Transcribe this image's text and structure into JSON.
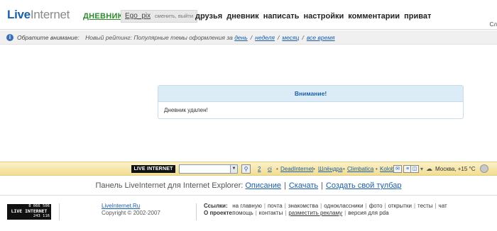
{
  "header": {
    "logo_live": "Live",
    "logo_internet": "Internet",
    "diaries_label": "ДНЕВНИКИ",
    "username": "Ego_pix",
    "user_links": "сменить, выйти",
    "menu": [
      "друзья",
      "дневник",
      "написать",
      "настройки",
      "комментарии",
      "приват"
    ],
    "corner_text": "Сл"
  },
  "notice": {
    "label": "Обратите внимание:",
    "text": "Новый рейтинг: Популярные темы оформления за",
    "links": [
      "день",
      "неделя",
      "месяц",
      "все время"
    ],
    "separator": "/"
  },
  "alert": {
    "title": "Внимание!",
    "message": "Дневник удален!"
  },
  "toolbar": {
    "logo_text": "LIVE INTERNET",
    "search_value": "",
    "count_2": "2",
    "count_ci": "ci",
    "links": [
      "DeadInternet",
      "Шлёндра",
      "Climbatica",
      "Kolob"
    ],
    "weather": "Москва, +15 °C"
  },
  "ie_panel": {
    "text": "Панель LiveInternet для Internet Explorer:",
    "links": [
      "Описание",
      "Скачать",
      "Создать свой тулбар"
    ],
    "separator": "|"
  },
  "footer": {
    "counter_top": "8 066 506",
    "counter_brand": "LIVE INTERNET",
    "counter_bottom": "243 116",
    "site_link": "LiveInternet.Ru",
    "copyright": "Copyright © 2002-2007",
    "links_label": "Ссылки:",
    "links": [
      "на главную",
      "почта",
      "знакомства",
      "одноклассники",
      "фото",
      "открытки",
      "тесты",
      "чат"
    ],
    "about_label": "О проекте:",
    "about_links": [
      "помощь",
      "контакты",
      "разместить рекламу",
      "версия для pda"
    ],
    "separator": "|"
  }
}
